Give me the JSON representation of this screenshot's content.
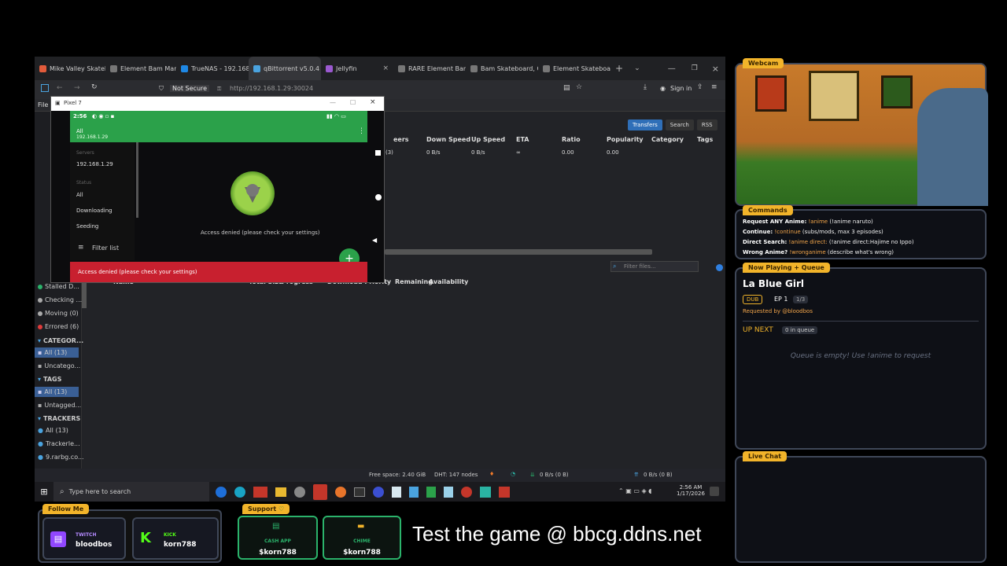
{
  "browser": {
    "tabs": [
      {
        "label": "Mike Valley Skatebo",
        "color": "#e25b3b"
      },
      {
        "label": "Element Bam Marg",
        "color": "#888"
      },
      {
        "label": "TrueNAS - 192.168.",
        "color": "#1e88e5"
      },
      {
        "label": "qBittorrent v5.0.4 W",
        "color": "#4aa3df"
      },
      {
        "label": "Jellyfin",
        "color": "#9b59d0"
      },
      {
        "label": "RARE Element Bam",
        "color": "#888"
      },
      {
        "label": "Bam Skateboard, C",
        "color": "#888"
      },
      {
        "label": "Element Skateboar",
        "color": "#888"
      }
    ],
    "not_secure": "Not Secure",
    "url": "http://192.168.1.29:30024",
    "sign_in": "Sign in"
  },
  "qbittorrent": {
    "file_menu": "File",
    "tabs": [
      "Transfers",
      "Search",
      "RSS"
    ],
    "columns": [
      "eers",
      "Down Speed",
      "Up Speed",
      "ETA",
      "Ratio",
      "Popularity",
      "Category",
      "Tags"
    ],
    "row": {
      "peers": "(3)",
      "down": "0 B/s",
      "up": "0 B/s",
      "eta": "∞",
      "ratio": "0.00",
      "popularity": "0.00"
    },
    "filter_placeholder": "Filter files...",
    "file_columns": [
      "Name",
      "Total Size",
      "Progress",
      "Download Priority",
      "Remaining",
      "Availability"
    ],
    "sidebar": {
      "items": [
        "Stalled D...",
        "Checking ...",
        "Moving (0)",
        "Errored (6)"
      ],
      "categories_header": "CATEGOR...",
      "categories": [
        "All (13)",
        "Uncatego..."
      ],
      "tags_header": "TAGS",
      "tags": [
        "All (13)",
        "Untagged..."
      ],
      "trackers_header": "TRACKERS",
      "trackers": [
        "All (13)",
        "Trackerle...",
        "9.rarbg.co..."
      ]
    },
    "status": {
      "free_space": "Free space: 2.40 GiB",
      "dht": "DHT: 147 nodes",
      "down": "0 B/s (0 B)",
      "up": "0 B/s (0 B)"
    }
  },
  "pixel": {
    "window_title": "Pixel 7",
    "time": "2:56",
    "header_title": "All",
    "header_sub": "192.168.1.29",
    "servers_label": "Servers",
    "server": "192.168.1.29",
    "status_label": "Status",
    "status_items": [
      "All",
      "Downloading",
      "Seeding"
    ],
    "filter_list": "Filter list",
    "message": "Access denied (please check your settings)",
    "snackbar": "Access denied (please check your settings)"
  },
  "taskbar": {
    "search_placeholder": "Type here to search",
    "time": "2:56 AM",
    "date": "1/17/2026"
  },
  "overlay": {
    "webcam_label": "Webcam",
    "commands_label": "Commands",
    "commands": [
      {
        "key": "Request ANY Anime:",
        "cmd": "!anime",
        "desc": "(!anime naruto)"
      },
      {
        "key": "Continue:",
        "cmd": "!continue",
        "desc": "(subs/mods, max 3 episodes)"
      },
      {
        "key": "Direct Search:",
        "cmd": "!anime direct:",
        "desc": "(!anime direct:Hajime no Ippo)"
      },
      {
        "key": "Wrong Anime?",
        "cmd": "!wronganime",
        "desc": "(describe what's wrong)"
      }
    ],
    "now_playing_label": "Now Playing + Queue",
    "anime_title": "La Blue Girl",
    "dub": "DUB",
    "episode": "EP 1",
    "episode_count": "1/3",
    "requested_by": "Requested by @bloodbos",
    "up_next": "UP NEXT",
    "queue_count": "0 in queue",
    "queue_empty": "Queue is empty! Use !anime to request",
    "live_chat_label": "Live Chat",
    "follow_label": "Follow Me",
    "twitch_label": "TWITCH",
    "twitch_user": "bloodbos",
    "kick_label": "KICK",
    "kick_user": "korn788",
    "support_label": "Support",
    "cashapp_label": "CASH APP",
    "cashapp_user": "$korn788",
    "chime_label": "CHIME",
    "chime_user": "$korn788",
    "banner": "Test the game @ bbcg.ddns.net"
  }
}
